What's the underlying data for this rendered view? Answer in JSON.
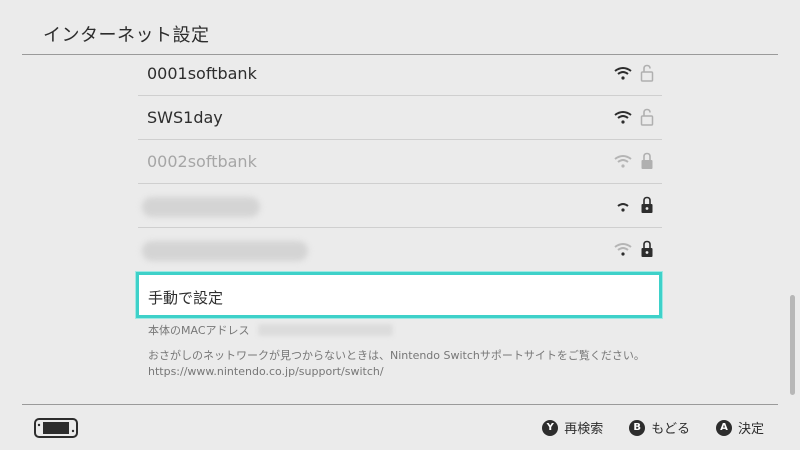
{
  "header": {
    "title": "インターネット設定"
  },
  "networks": [
    {
      "name": "0001softbank",
      "hidden": false,
      "dim": false,
      "lock_icon": "lock-open-icon"
    },
    {
      "name": "SWS1day",
      "hidden": false,
      "dim": false,
      "lock_icon": "lock-open-icon"
    },
    {
      "name": "0002softbank",
      "hidden": false,
      "dim": true,
      "lock_icon": "lock-icon"
    },
    {
      "name": "",
      "hidden": true,
      "dim": false,
      "lock_icon": "lock-icon"
    },
    {
      "name": "",
      "hidden": true,
      "dim": false,
      "lock_icon": "lock-icon"
    }
  ],
  "manual": {
    "label": "手動で設定"
  },
  "mac": {
    "label": "本体のMACアドレス"
  },
  "help": {
    "line1": "おさがしのネットワークが見つからないときは、Nintendo Switchサポートサイトをご覧ください。",
    "line2": "https://www.nintendo.co.jp/support/switch/"
  },
  "footer": {
    "research": {
      "key": "Y",
      "label": "再検索"
    },
    "back": {
      "key": "B",
      "label": "もどる"
    },
    "confirm": {
      "key": "A",
      "label": "決定"
    }
  },
  "colors": {
    "selection": "#3ed1c9",
    "background": "#ebebeb"
  }
}
